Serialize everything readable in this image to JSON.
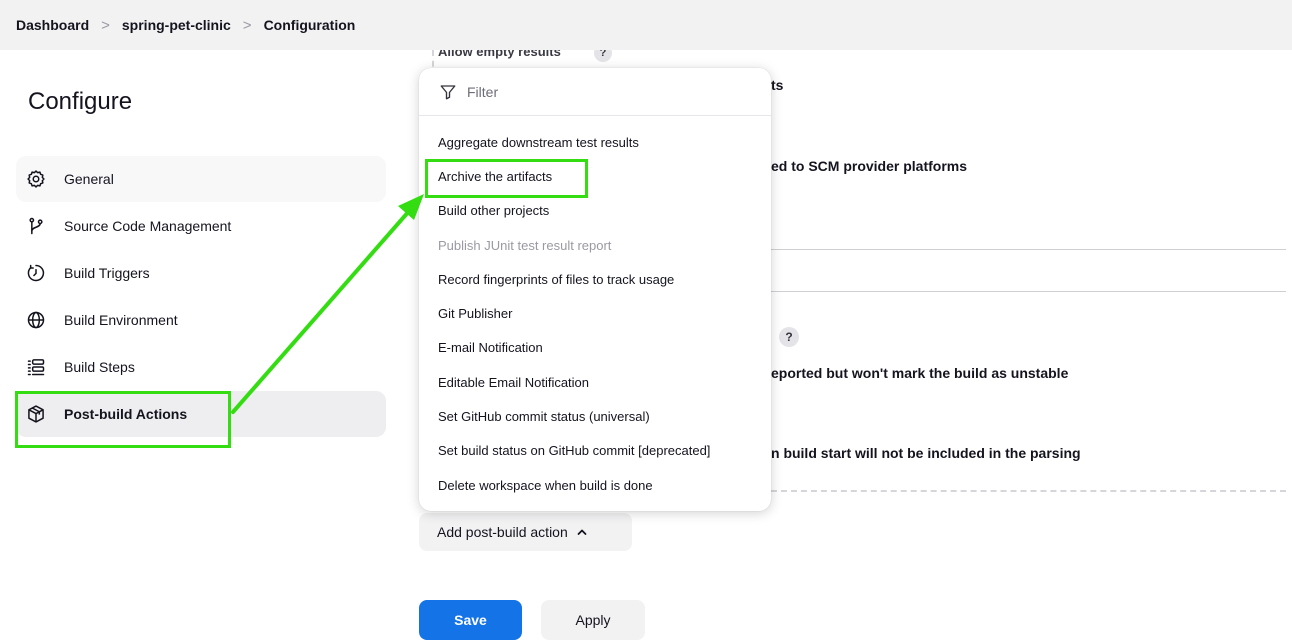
{
  "breadcrumb": {
    "items": [
      "Dashboard",
      "spring-pet-clinic",
      "Configuration"
    ],
    "separator": ">"
  },
  "sidebar": {
    "title": "Configure",
    "items": [
      {
        "label": "General",
        "icon": "gear-icon"
      },
      {
        "label": "Source Code Management",
        "icon": "source-branch-icon"
      },
      {
        "label": "Build Triggers",
        "icon": "timer-icon"
      },
      {
        "label": "Build Environment",
        "icon": "globe-icon"
      },
      {
        "label": "Build Steps",
        "icon": "list-icon"
      },
      {
        "label": "Post-build Actions",
        "icon": "package-icon",
        "active": true
      }
    ]
  },
  "background": {
    "partial_top": "Allow empty results",
    "partial_1": "ts",
    "partial_2": "ed to SCM provider platforms",
    "help_mark": "?",
    "partial_3": "eported but won't mark the build as unstable",
    "partial_4": "n build start will not be included in the parsing"
  },
  "dropdown": {
    "filter_placeholder": "Filter",
    "items": [
      {
        "label": "Aggregate downstream test results",
        "disabled": false
      },
      {
        "label": "Archive the artifacts",
        "disabled": false,
        "highlighted": true
      },
      {
        "label": "Build other projects",
        "disabled": false
      },
      {
        "label": "Publish JUnit test result report",
        "disabled": true
      },
      {
        "label": "Record fingerprints of files to track usage",
        "disabled": false
      },
      {
        "label": "Git Publisher",
        "disabled": false
      },
      {
        "label": "E-mail Notification",
        "disabled": false
      },
      {
        "label": "Editable Email Notification",
        "disabled": false
      },
      {
        "label": "Set GitHub commit status (universal)",
        "disabled": false
      },
      {
        "label": "Set build status on GitHub commit [deprecated]",
        "disabled": false
      },
      {
        "label": "Delete workspace when build is done",
        "disabled": false
      }
    ]
  },
  "add_action": {
    "label": "Add post-build action"
  },
  "buttons": {
    "save": "Save",
    "apply": "Apply"
  },
  "colors": {
    "primary": "#1473e6",
    "annotation": "#33dd11",
    "breadcrumb_bg": "#f2f2f3"
  }
}
